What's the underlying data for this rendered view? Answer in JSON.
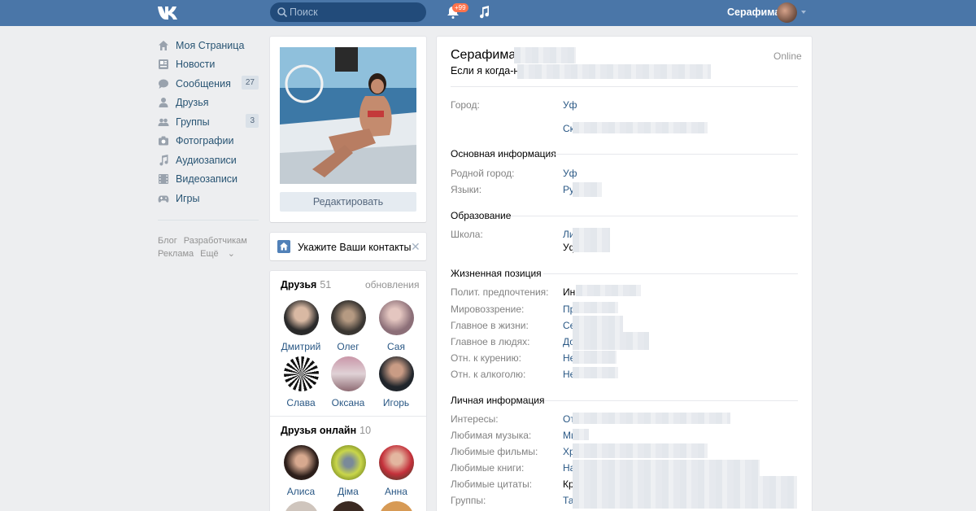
{
  "header": {
    "search_placeholder": "Поиск",
    "notifications_badge": "+99",
    "user_name": "Серафима",
    "colors": {
      "bar": "#4a76a8",
      "badge": "#ff734c"
    }
  },
  "sidebar": {
    "items": [
      {
        "label": "Моя Страница",
        "icon": "home-icon"
      },
      {
        "label": "Новости",
        "icon": "news-icon"
      },
      {
        "label": "Сообщения",
        "icon": "messages-icon",
        "count": "27"
      },
      {
        "label": "Друзья",
        "icon": "friends-icon"
      },
      {
        "label": "Группы",
        "icon": "groups-icon",
        "count": "3"
      },
      {
        "label": "Фотографии",
        "icon": "camera-icon"
      },
      {
        "label": "Аудиозаписи",
        "icon": "music-icon"
      },
      {
        "label": "Видеозаписи",
        "icon": "video-icon"
      },
      {
        "label": "Игры",
        "icon": "gamepad-icon"
      }
    ],
    "footer": {
      "blog": "Блог",
      "developers": "Разработчикам",
      "ads": "Реклама",
      "more": "Ещё"
    }
  },
  "profile_card": {
    "edit_button": "Редактировать"
  },
  "contacts_prompt": {
    "text": "Укажите Ваши контакты"
  },
  "friends": {
    "title": "Друзья",
    "count": "51",
    "updates_link": "обновления",
    "list": [
      {
        "name": "Дмитрий"
      },
      {
        "name": "Олег"
      },
      {
        "name": "Сая"
      },
      {
        "name": "Слава"
      },
      {
        "name": "Оксана"
      },
      {
        "name": "Игорь"
      }
    ]
  },
  "friends_online": {
    "title": "Друзья онлайн",
    "count": "10",
    "list": [
      {
        "name": "Алиса"
      },
      {
        "name": "Діма"
      },
      {
        "name": "Анна"
      }
    ]
  },
  "profile": {
    "name": "Серафима",
    "status": "Если я когда-ни",
    "online": "Online",
    "city_label": "Город:",
    "city_value": "Уф",
    "city_extra": "Ск",
    "sections": {
      "basic": "Основная информация",
      "education": "Образование",
      "life": "Жизненная позиция",
      "personal": "Личная информация"
    },
    "basic": [
      {
        "label": "Родной город:",
        "value": "Уф"
      },
      {
        "label": "Языки:",
        "value": "Ру"
      }
    ],
    "education": {
      "label": "Школа:",
      "value1": "Ли",
      "value2": "Уф"
    },
    "life": [
      {
        "label": "Полит. предпочтения:",
        "value": "Ин"
      },
      {
        "label": "Мировоззрение:",
        "value": "Пр"
      },
      {
        "label": "Главное в жизни:",
        "value": "Се"
      },
      {
        "label": "Главное в людях:",
        "value": "До"
      },
      {
        "label": "Отн. к курению:",
        "value": "Не"
      },
      {
        "label": "Отн. к алкоголю:",
        "value": "Не"
      }
    ],
    "personal": [
      {
        "label": "Интересы:",
        "value": "От"
      },
      {
        "label": "Любимая музыка:",
        "value": "Ми"
      },
      {
        "label": "Любимые фильмы:",
        "value": "Хр"
      },
      {
        "label": "Любимые книги:",
        "value": "На"
      },
      {
        "label": "Любимые цитаты:",
        "value": "Кр"
      },
      {
        "label": "Группы:",
        "value": "Та"
      }
    ]
  }
}
